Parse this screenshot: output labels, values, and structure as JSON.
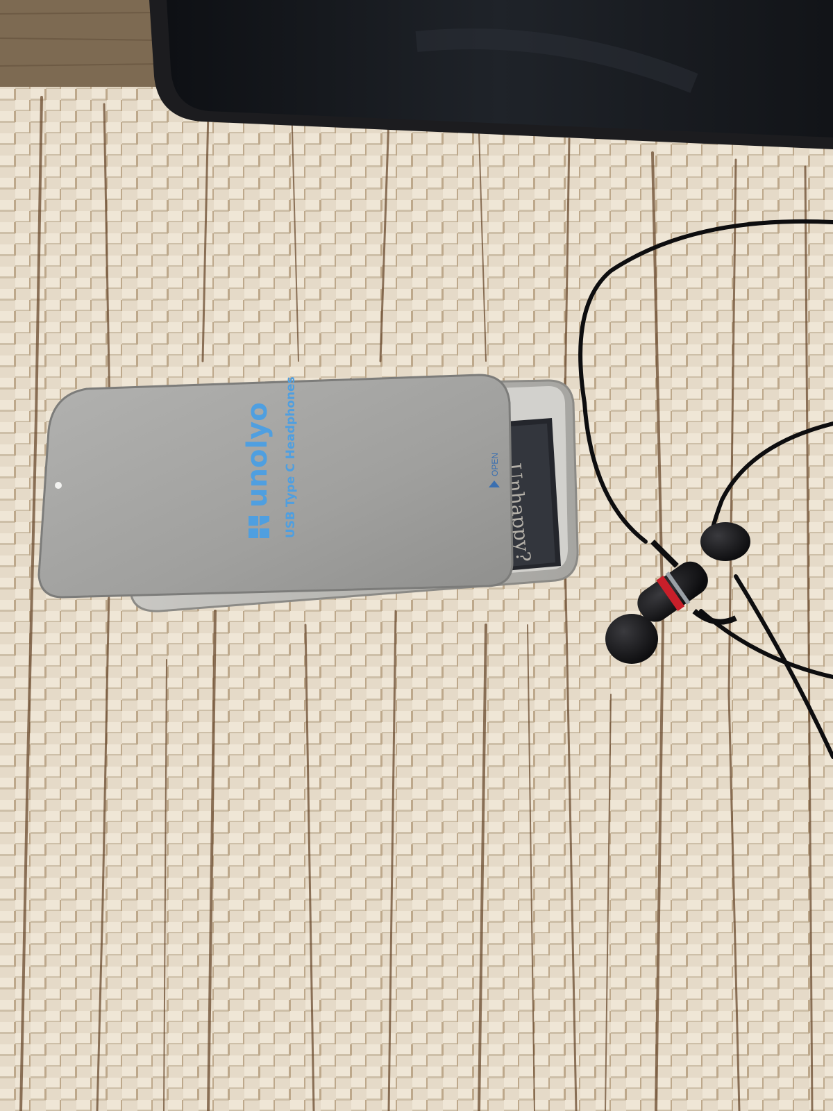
{
  "scene": {
    "description_labels": {
      "tin_brand": "unolyo",
      "tin_subtitle": "USB Type C Headphones",
      "tin_open_label": "OPEN",
      "card_text": "Unhappy?"
    }
  },
  "colors": {
    "mat_light": "#e7dccb",
    "mat_dark": "#6a4a2e",
    "tin_lid": "#a3a3a1",
    "tin_base": "#b9b8b4",
    "brand_blue": "#4f9fe0",
    "tablet": "#17181b",
    "cable": "#0d0d0f",
    "accent_red": "#c81f2a"
  },
  "icons": {
    "brand_logo": "unolyo-logo-icon",
    "open_arrow": "up-arrow-icon"
  }
}
